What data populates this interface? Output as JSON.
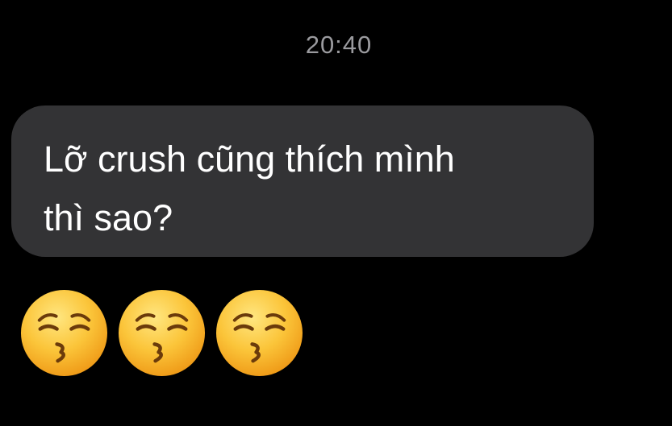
{
  "conversation": {
    "timestamp": "20:40",
    "incoming_message": {
      "text": "Lỡ crush cũng thích mình\nthì sao?"
    },
    "emoji_message": {
      "count": 3,
      "icon": "kissing-face-with-closed-eyes-icon"
    }
  },
  "colors": {
    "background": "#000000",
    "timestamp": "#9a9a9e",
    "bubble": "#333335",
    "bubble_text": "#ffffff",
    "emoji_face": "#f7b72e"
  }
}
